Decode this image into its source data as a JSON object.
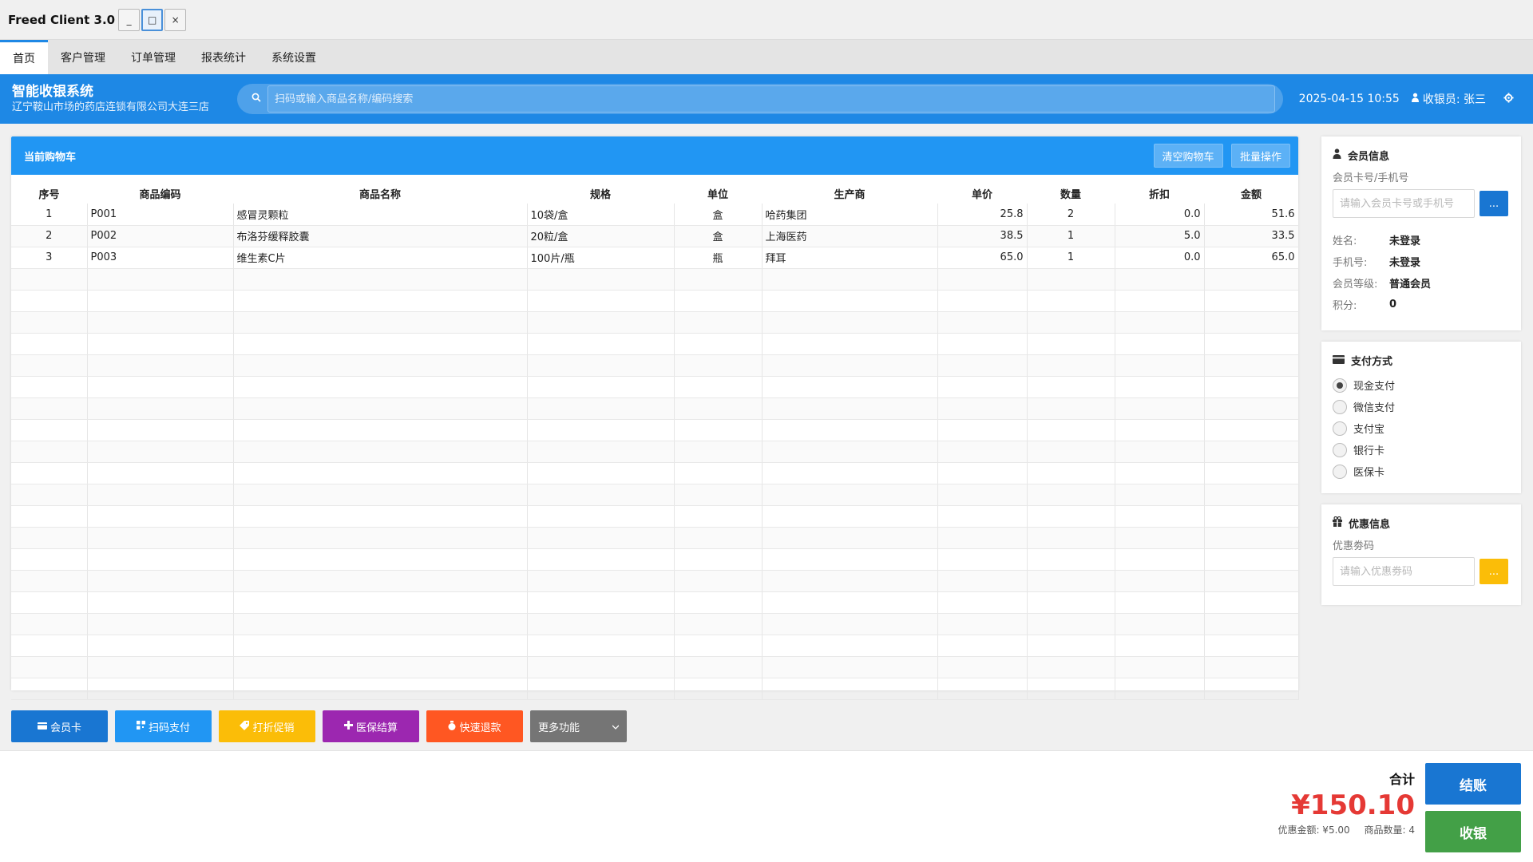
{
  "window": {
    "title": "Freed Client 3.0",
    "minimize": "_",
    "maximize": "□",
    "close": "×"
  },
  "menu": [
    "首页",
    "客户管理",
    "订单管理",
    "报表统计",
    "系统设置"
  ],
  "header": {
    "title": "智能收银系统",
    "subtitle": "辽宁鞍山市场的药店连锁有限公司大连三店",
    "search_placeholder": "扫码或输入商品名称/编码搜索",
    "datetime": "2025-04-15 10:55",
    "cashier": "收银员: 张三"
  },
  "cart": {
    "title": "当前购物车",
    "clear_label": "清空购物车",
    "batch_label": "批量操作",
    "columns": [
      "序号",
      "商品编码",
      "商品名称",
      "规格",
      "单位",
      "生产商",
      "单价",
      "数量",
      "折扣",
      "金额"
    ],
    "rows": [
      [
        "1",
        "P001",
        "感冒灵颗粒",
        "10袋/盒",
        "盒",
        "哈药集团",
        "25.8",
        "2",
        "0.0",
        "51.6"
      ],
      [
        "2",
        "P002",
        "布洛芬缓释胶囊",
        "20粒/盒",
        "盒",
        "上海医药",
        "38.5",
        "1",
        "5.0",
        "33.5"
      ],
      [
        "3",
        "P003",
        "维生素C片",
        "100片/瓶",
        "瓶",
        "拜耳",
        "65.0",
        "1",
        "0.0",
        "65.0"
      ]
    ]
  },
  "actions": {
    "member_card": "会员卡",
    "scan_pay": "扫码支付",
    "discount": "打折促销",
    "insurance": "医保结算",
    "refund": "快速退款",
    "more": "更多功能"
  },
  "summary": {
    "total_label": "合计",
    "total_amount": "¥150.10",
    "discount_amount": "优惠金额: ¥5.00",
    "item_count": "商品数量: 4",
    "checkout_label": "结账",
    "collect_label": "收银"
  },
  "member": {
    "title": "会员信息",
    "field_label": "会员卡号/手机号",
    "placeholder": "请输入会员卡号或手机号",
    "search_btn": "...",
    "name_label": "姓名:",
    "name_value": "未登录",
    "phone_label": "手机号:",
    "phone_value": "未登录",
    "level_label": "会员等级:",
    "level_value": "普通会员",
    "points_label": "积分:",
    "points_value": "0"
  },
  "payment": {
    "title": "支付方式",
    "options": [
      "现金支付",
      "微信支付",
      "支付宝",
      "银行卡",
      "医保卡"
    ],
    "selected": "现金支付"
  },
  "coupon": {
    "title": "优惠信息",
    "field_label": "优惠劵码",
    "placeholder": "请输入优惠劵码",
    "apply_btn": "..."
  },
  "colors": {
    "primary": "#1e88e5",
    "cart_header": "#2196f3",
    "total_red": "#e53935",
    "collect_green": "#43a047"
  }
}
